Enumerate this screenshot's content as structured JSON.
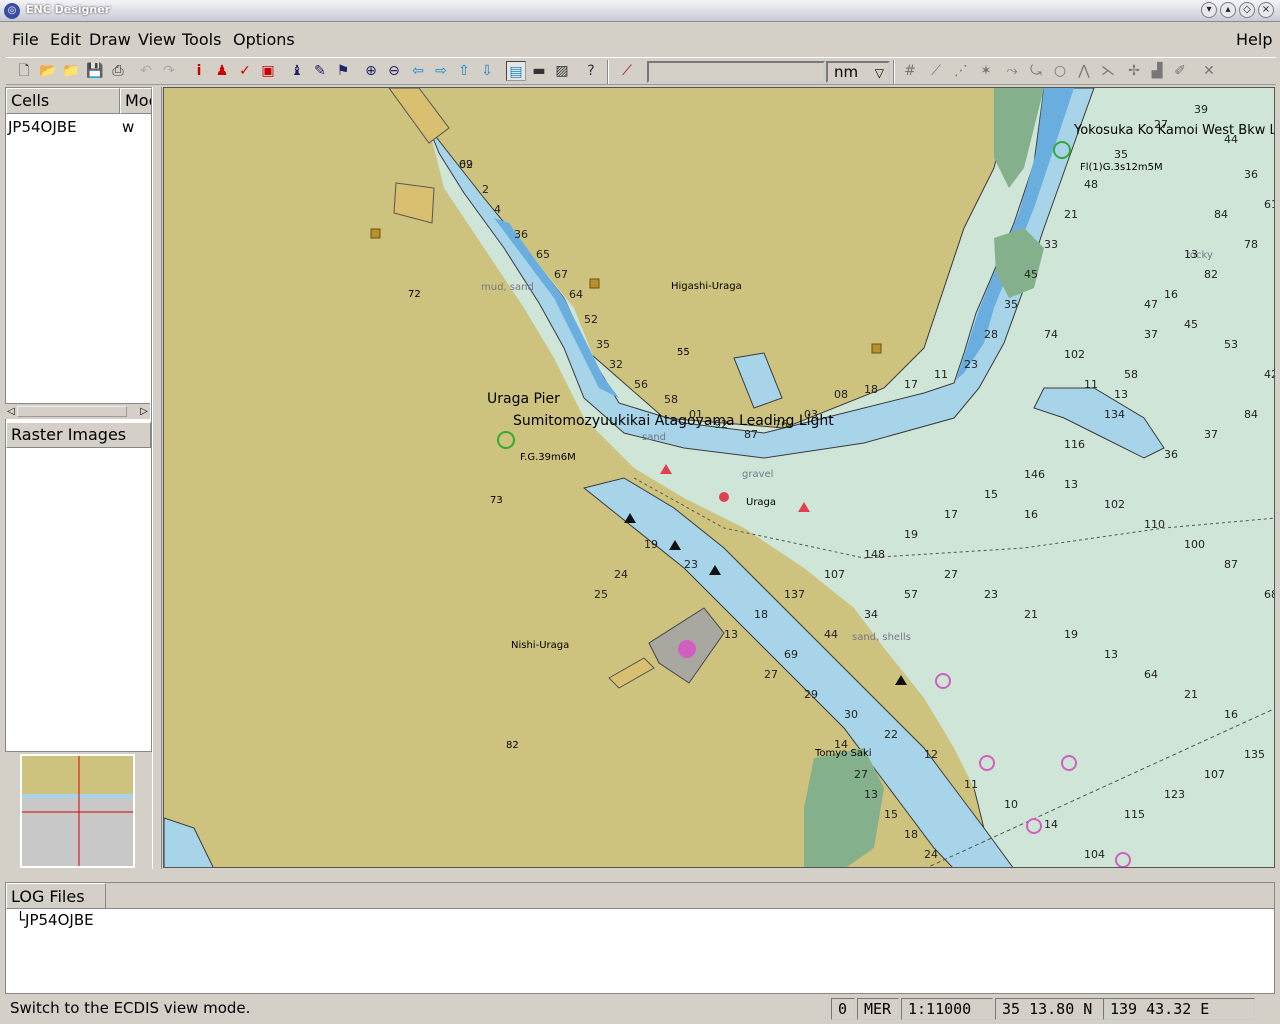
{
  "window": {
    "title": "ENC Designer"
  },
  "menu": {
    "file": "File",
    "edit": "Edit",
    "draw": "Draw",
    "view": "View",
    "tools": "Tools",
    "options": "Options",
    "help": "Help"
  },
  "toolbar": {
    "distance_value": "",
    "unit": "nm"
  },
  "cells_panel": {
    "headers": {
      "cells": "Cells",
      "mode": "Moc"
    },
    "rows": [
      {
        "cell": "JP54OJBE",
        "mode": "w"
      }
    ]
  },
  "raster_panel": {
    "header": "Raster Images"
  },
  "map": {
    "labels": {
      "uraga_pier": "Uraga Pier",
      "leading_light": "Sumitomozyuukikai Atagoyama Leading Light",
      "higashi_uraga": "Higashi-Uraga",
      "nishi_uraga": "Nishi-Uraga",
      "uraga": "Uraga",
      "tomyo_saki": "Tomyo Saki",
      "yokosuka": "Yokosuka Ko Kamoi West Bkw L",
      "light_char_1": "F.G.39m6M",
      "light_char_2": "Fl(1)G.3s12m5M",
      "sand": "sand",
      "mud_sand": "mud, sand",
      "rocky": "rocky",
      "gravel": "gravel",
      "sand_shells": "sand, shells"
    },
    "land_heights": [
      "72",
      "55",
      "73",
      "82"
    ],
    "soundings": [
      "62",
      "2",
      "4",
      "36",
      "65",
      "67",
      "64",
      "52",
      "35",
      "32",
      "56",
      "58",
      "01",
      "92",
      "87",
      "76",
      "03",
      "08",
      "18",
      "17",
      "11",
      "23",
      "28",
      "35",
      "45",
      "33",
      "21",
      "48",
      "35",
      "27",
      "39",
      "44",
      "36",
      "84",
      "13",
      "16",
      "37",
      "58",
      "134",
      "116",
      "146",
      "15",
      "17",
      "19",
      "148",
      "107",
      "137",
      "18",
      "13",
      "23",
      "19",
      "24",
      "25",
      "27",
      "29",
      "30",
      "22",
      "12",
      "11",
      "10",
      "14",
      "104",
      "115",
      "123",
      "107",
      "135",
      "16",
      "21",
      "64",
      "13",
      "19",
      "21",
      "23",
      "27",
      "57",
      "34",
      "44",
      "69",
      "68",
      "87",
      "100",
      "110",
      "102",
      "13",
      "16",
      "36",
      "37",
      "84",
      "42",
      "53",
      "45",
      "47",
      "82",
      "78",
      "61",
      "74",
      "102",
      "11",
      "13",
      "13",
      "15",
      "18",
      "24",
      "27",
      "14",
      "09"
    ],
    "colors": {
      "land": "#cec37e",
      "deep": "#cfe5d8",
      "shallow": "#a8d4ea",
      "very_shallow": "#6aaee0",
      "drying": "#84b08c",
      "coast_line": "#3a3a3a"
    }
  },
  "log_panel": {
    "header": "LOG Files",
    "items": [
      "JP54OJBE"
    ]
  },
  "status": {
    "message": "Switch to the ECDIS view mode.",
    "field_0": "0",
    "projection": "MER",
    "scale": "1:11000",
    "lat": "35 13.80 N",
    "lon": "139 43.32 E"
  }
}
